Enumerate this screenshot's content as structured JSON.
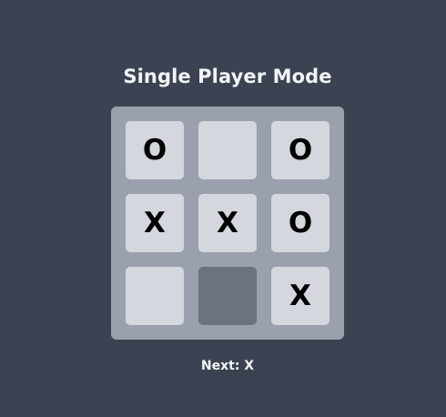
{
  "title": "Single Player Mode",
  "board": {
    "cells": [
      "O",
      "",
      "O",
      "X",
      "X",
      "O",
      "",
      "",
      "X"
    ],
    "highlighted_cell": 7
  },
  "status": "Next: X",
  "colors": {
    "background": "#3b4252",
    "board": "#9aa1ad",
    "cell": "#d4d7de",
    "cell_highlight": "#6b7280",
    "mark": "#000000",
    "text": "#f2f4f8"
  }
}
